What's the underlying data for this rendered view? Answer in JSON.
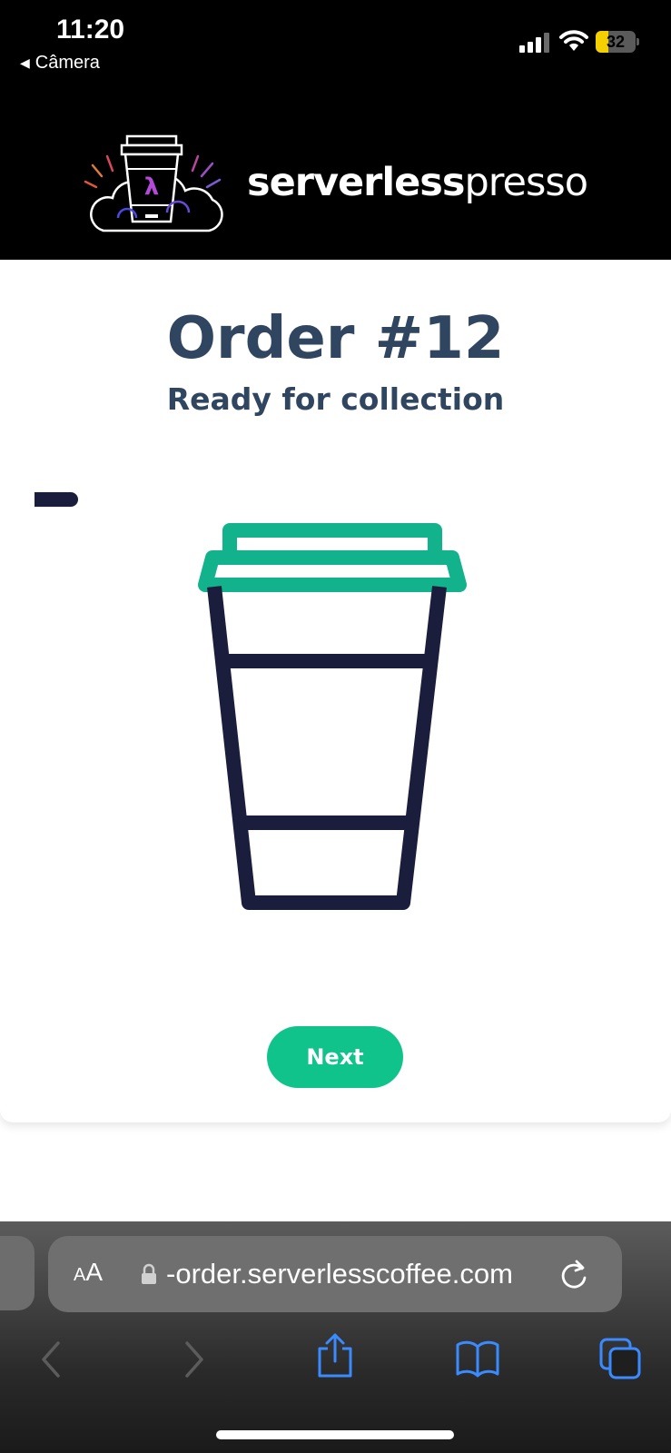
{
  "status_bar": {
    "time": "11:20",
    "back_app": "Câmera",
    "battery_level": "32",
    "battery_fraction": 0.32,
    "battery_color": "#f5d000"
  },
  "header": {
    "brand_bold": "serverless",
    "brand_light": "presso",
    "logo_icon": "coffee-cup-cloud-logo"
  },
  "order": {
    "title": "Order #12",
    "status": "Ready for collection",
    "illustration": "coffee-cup-icon",
    "next_label": "Next"
  },
  "browser": {
    "text_size_label_small": "A",
    "text_size_label_big": "A",
    "url": "-order.serverlesscoffee.com",
    "icons": [
      "lock-icon",
      "reload-icon",
      "back-icon",
      "forward-icon",
      "share-icon",
      "bookmarks-icon",
      "tabs-icon"
    ]
  },
  "colors": {
    "title": "#2f4560",
    "accent_green": "#0fc38a",
    "cup_lid": "#12b38c",
    "cup_body": "#1b1d3d"
  }
}
